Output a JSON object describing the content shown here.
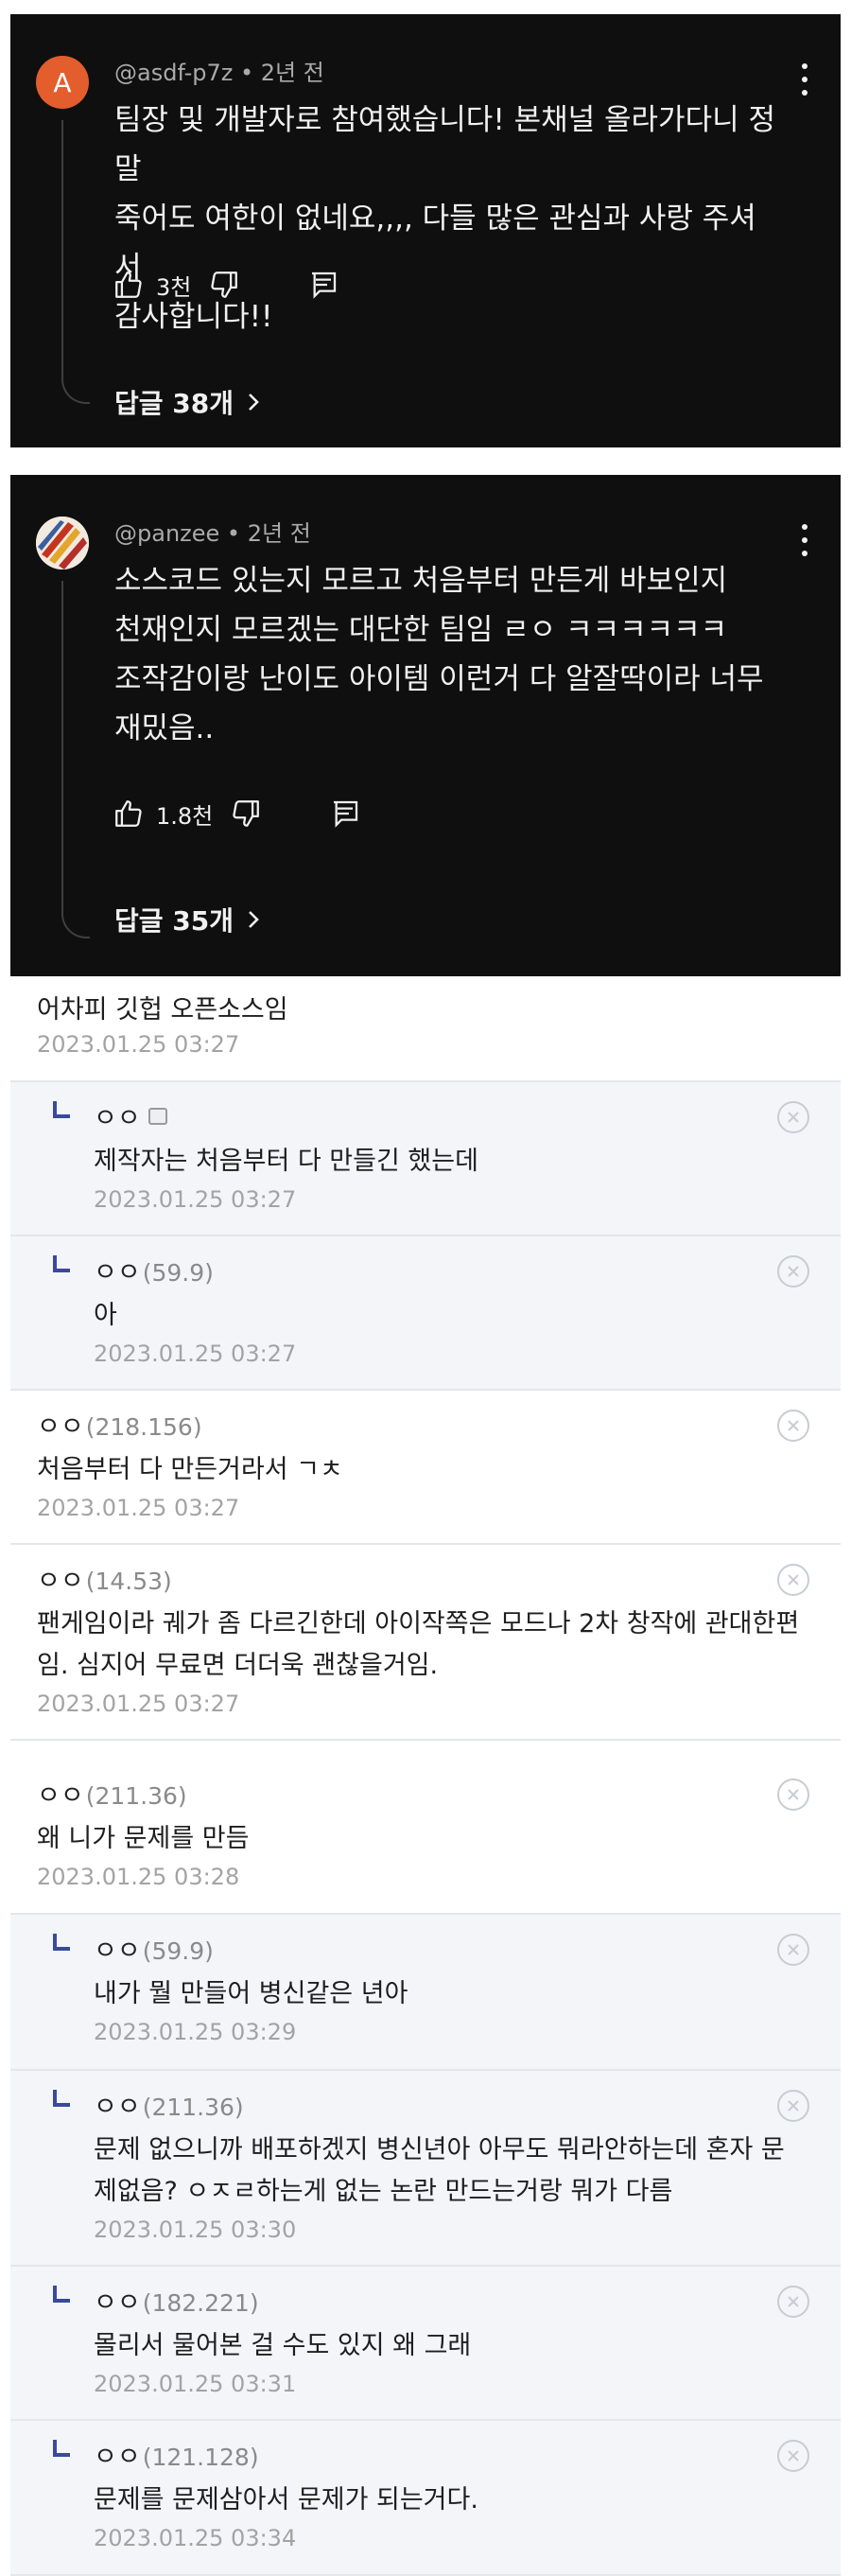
{
  "yt_comments": [
    {
      "avatar_letter": "A",
      "avatar_color": "#e35d2d",
      "handle": "@asdf-p7z",
      "time": "2년 전",
      "lines": [
        "팀장 및 개발자로 참여했습니다! 본채널 올라가다니 정말",
        "죽어도 여한이 없네요,,,, 다들 많은 관심과 사랑 주셔서",
        "감사합니다!!"
      ],
      "likes": "3천",
      "replies": "답글 38개"
    },
    {
      "avatar_letter": "",
      "avatar_color": "#d8532b",
      "handle": "@panzee",
      "time": "2년 전",
      "lines": [
        "소스코드 있는지 모르고 처음부터 만든게 바보인지",
        "천재인지 모르겠는 대단한 팀임 ㄹㅇ ㅋㅋㅋㅋㅋㅋ",
        "조작감이랑 난이도 아이템 이런거 다 알잘딱이라 너무",
        "재밌음.."
      ],
      "likes": "1.8천",
      "replies": "답글 35개"
    }
  ],
  "board_comments": [
    {
      "author": "",
      "ip": "",
      "text": "어차피 깃헙 오픈소스임",
      "date": "2023.01.25 03:27",
      "reply": false
    },
    {
      "author": "ㅇㅇ",
      "ip": "",
      "text": "제작자는 처음부터 다 만들긴 했는데",
      "date": "2023.01.25 03:27",
      "reply": true
    },
    {
      "author": "ㅇㅇ",
      "ip": "(59.9)",
      "text": "아",
      "date": "2023.01.25 03:27",
      "reply": true
    },
    {
      "author": "ㅇㅇ",
      "ip": "(218.156)",
      "text": "처음부터 다 만든거라서 ㄱㅊ",
      "date": "2023.01.25 03:27",
      "reply": false
    },
    {
      "author": "ㅇㅇ",
      "ip": "(14.53)",
      "text_lines": [
        "팬게임이라 궤가 좀 다르긴한데 아이작쪽은 모드나 2차 창작에 관대한편",
        "임. 심지어 무료면 더더욱 괜찮을거임."
      ],
      "date": "2023.01.25 03:27",
      "reply": false
    },
    {
      "author": "ㅇㅇ",
      "ip": "(211.36)",
      "text": "왜 니가 문제를 만듬",
      "date": "2023.01.25 03:28",
      "reply": false
    },
    {
      "author": "ㅇㅇ",
      "ip": "(59.9)",
      "text": "내가 뭘 만들어 병신같은 년아",
      "date": "2023.01.25 03:29",
      "reply": true
    },
    {
      "author": "ㅇㅇ",
      "ip": "(211.36)",
      "text_lines": [
        "문제 없으니까 배포하겠지 병신년아 아무도 뭐라안하는데 혼자 문",
        "제없음? ㅇㅈㄹ하는게 없는 논란 만드는거랑 뭐가 다름"
      ],
      "date": "2023.01.25 03:30",
      "reply": true
    },
    {
      "author": "ㅇㅇ",
      "ip": "(182.221)",
      "text": "몰리서 물어본 걸 수도 있지 왜 그래",
      "date": "2023.01.25 03:31",
      "reply": true
    },
    {
      "author": "ㅇㅇ",
      "ip": "(121.128)",
      "text": "문제를 문제삼아서 문제가 되는거다.",
      "date": "2023.01.25 03:34",
      "reply": true
    }
  ]
}
